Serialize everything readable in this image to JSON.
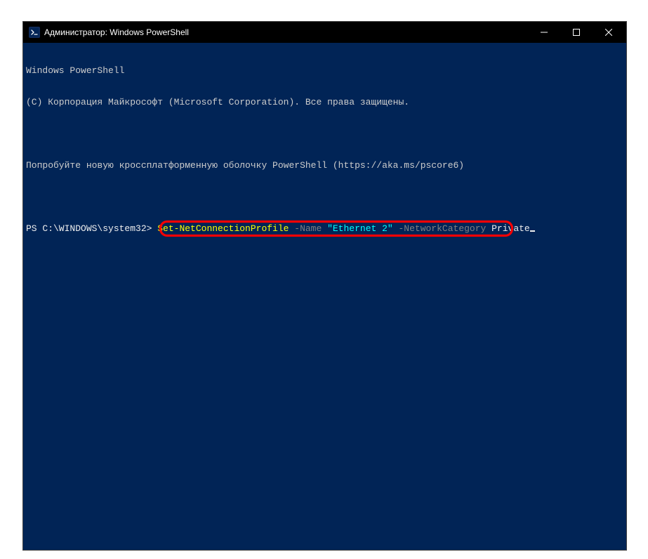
{
  "titlebar": {
    "title": "Администратор: Windows PowerShell"
  },
  "terminal": {
    "header1": "Windows PowerShell",
    "header2": "(C) Корпорация Майкрософт (Microsoft Corporation). Все права защищены.",
    "notice": "Попробуйте новую кроссплатформенную оболочку PowerShell (https://aka.ms/pscore6)",
    "prompt": "PS C:\\WINDOWS\\system32> ",
    "command": {
      "cmdlet": "Set-NetConnectionProfile",
      "param1": " -Name",
      "val1": " \"Ethernet 2\"",
      "param2": " -NetworkCategory",
      "val2": " Private"
    }
  }
}
